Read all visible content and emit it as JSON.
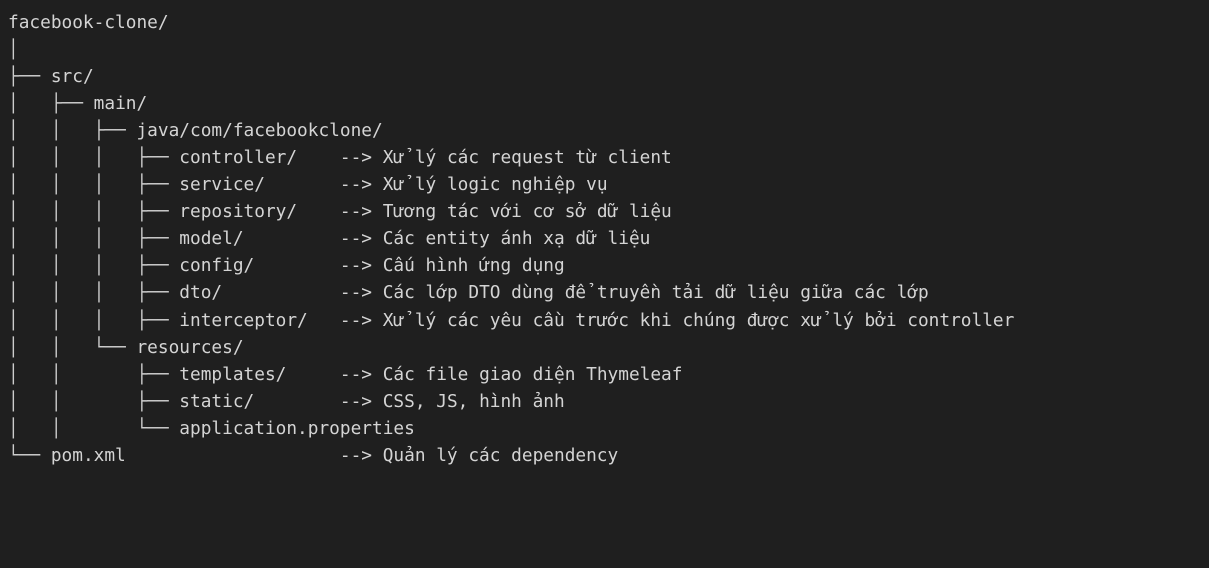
{
  "colors": {
    "background": "#1f1f1f",
    "text": "#d4d4d4",
    "frame": "#ffffff"
  },
  "tree": [
    {
      "guide": "",
      "name": "facebook-clone/",
      "arrow": "",
      "note": ""
    },
    {
      "guide": "│",
      "name": "",
      "arrow": "",
      "note": ""
    },
    {
      "guide": "├── ",
      "name": "src/",
      "arrow": "",
      "note": ""
    },
    {
      "guide": "│   ├── ",
      "name": "main/",
      "arrow": "",
      "note": ""
    },
    {
      "guide": "│   │   ├── ",
      "name": "java/com/facebookclone/",
      "arrow": "",
      "note": ""
    },
    {
      "guide": "│   │   │   ├── ",
      "name": "controller/    ",
      "arrow": "--> ",
      "note": "Xử lý các request từ client"
    },
    {
      "guide": "│   │   │   ├── ",
      "name": "service/       ",
      "arrow": "--> ",
      "note": "Xử lý logic nghiệp vụ"
    },
    {
      "guide": "│   │   │   ├── ",
      "name": "repository/    ",
      "arrow": "--> ",
      "note": "Tương tác với cơ sở dữ liệu"
    },
    {
      "guide": "│   │   │   ├── ",
      "name": "model/         ",
      "arrow": "--> ",
      "note": "Các entity ánh xạ dữ liệu"
    },
    {
      "guide": "│   │   │   ├── ",
      "name": "config/        ",
      "arrow": "--> ",
      "note": "Cấu hình ứng dụng"
    },
    {
      "guide": "│   │   │   ├── ",
      "name": "dto/           ",
      "arrow": "--> ",
      "note": "Các lớp DTO dùng để truyền tải dữ liệu giữa các lớp"
    },
    {
      "guide": "│   │   │   ├── ",
      "name": "interceptor/   ",
      "arrow": "--> ",
      "note": "Xử lý các yêu cầu trước khi chúng được xử lý bởi controller"
    },
    {
      "guide": "│   │   └── ",
      "name": "resources/",
      "arrow": "",
      "note": ""
    },
    {
      "guide": "│   │       ├── ",
      "name": "templates/     ",
      "arrow": "--> ",
      "note": "Các file giao diện Thymeleaf"
    },
    {
      "guide": "│   │       ├── ",
      "name": "static/        ",
      "arrow": "--> ",
      "note": "CSS, JS, hình ảnh"
    },
    {
      "guide": "│   │       └── ",
      "name": "application.properties",
      "arrow": "",
      "note": ""
    },
    {
      "guide": "└── ",
      "name": "pom.xml                    ",
      "arrow": "--> ",
      "note": "Quản lý các dependency"
    }
  ]
}
